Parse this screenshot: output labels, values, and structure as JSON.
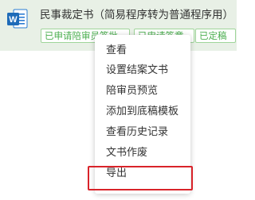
{
  "document": {
    "icon": "word-icon",
    "title": "民事裁定书（简易程序转为普通程序用）",
    "tags": [
      "已申请陪审员签批",
      "已申请签章",
      "已定稿"
    ]
  },
  "context_menu": {
    "items": [
      "查看",
      "设置结案文书",
      "陪审员预览",
      "添加到底稿模板",
      "查看历史记录",
      "文书作废",
      "导出"
    ],
    "highlighted_item": "导出",
    "highlight_color": "#d9232a"
  },
  "colors": {
    "row_background": "#e8f0e6",
    "tag_green": "#4caf50",
    "word_blue": "#1e6bb8"
  }
}
